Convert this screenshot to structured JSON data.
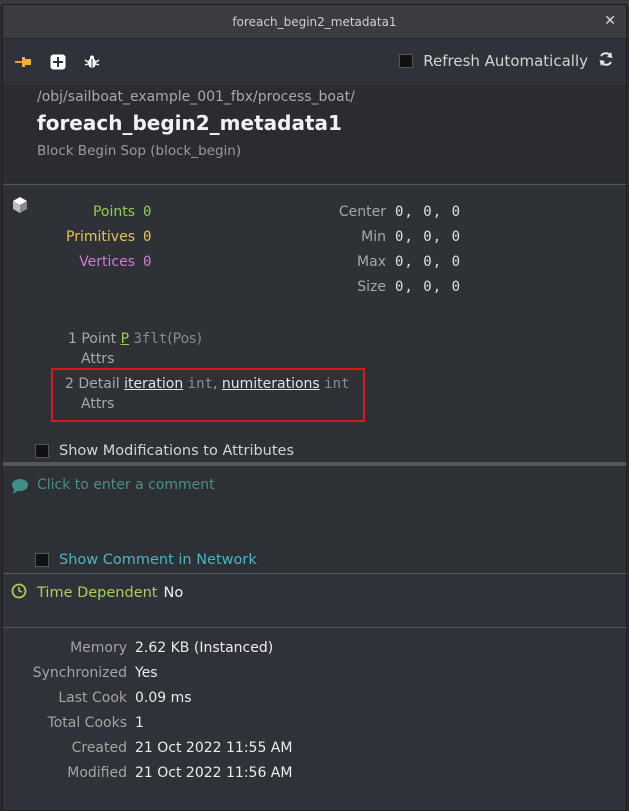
{
  "window": {
    "title": "foreach_begin2_metadata1",
    "close_glyph": "✕"
  },
  "toolbar": {
    "icons": [
      "pin-icon",
      "add-icon",
      "bug-icon"
    ],
    "refresh_label": "Refresh Automatically",
    "refresh_checked": false
  },
  "header": {
    "path": "/obj/sailboat_example_001_fbx/process_boat/",
    "node_name": "foreach_begin2_metadata1",
    "node_type": "Block Begin Sop (block_begin)"
  },
  "geometry": {
    "points_label": "Points",
    "points_value": "0",
    "primitives_label": "Primitives",
    "primitives_value": "0",
    "vertices_label": "Vertices",
    "vertices_value": "0",
    "center_label": "Center",
    "center_value": "0, 0, 0",
    "min_label": "Min",
    "min_value": "0, 0, 0",
    "max_label": "Max",
    "max_value": "0, 0, 0",
    "size_label": "Size",
    "size_value": "0, 0, 0",
    "point_attrs": {
      "count_label": "1 Point",
      "attrs_label": "Attrs",
      "name": "P",
      "type": "3flt",
      "qualifier": "(Pos)"
    },
    "detail_attrs": {
      "count_label": "2 Detail",
      "attrs_label": "Attrs",
      "attr1_name": "iteration",
      "attr1_type": "int",
      "sep": ",",
      "attr2_name": "numiterations",
      "attr2_type": "int"
    },
    "show_mods_label": "Show Modifications to Attributes"
  },
  "comment": {
    "placeholder": "Click to enter a comment",
    "show_in_network_label": "Show Comment in Network"
  },
  "time_dependent": {
    "label": "Time Dependent",
    "value": "No"
  },
  "info": [
    {
      "label": "Memory",
      "value": "2.62 KB (Instanced)"
    },
    {
      "label": "Synchronized",
      "value": "Yes"
    },
    {
      "label": "Last Cook",
      "value": "0.09 ms"
    },
    {
      "label": "Total Cooks",
      "value": "1"
    },
    {
      "label": "Created",
      "value": "21 Oct 2022 11:55 AM"
    },
    {
      "label": "Modified",
      "value": "21 Oct 2022 11:56 AM"
    }
  ],
  "colors": {
    "points": "#8fcf4a",
    "primitives": "#e8c64a",
    "vertices": "#d47ad8",
    "highlight_box": "#e0141c",
    "accent_teal": "#4bb4c4"
  }
}
